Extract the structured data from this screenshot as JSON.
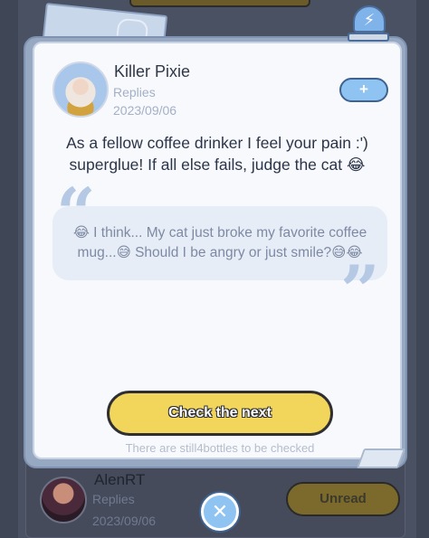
{
  "background_entry": {
    "name": "AlenRT",
    "subtitle": "Replies",
    "date": "2023/09/06",
    "status_button": "Unread"
  },
  "siren": {
    "icon": "lightning-icon",
    "glyph": "⚡"
  },
  "post": {
    "author": "Killer Pixie",
    "subtitle": "Replies",
    "date": "2023/09/06",
    "add_button_glyph": "+",
    "message": "As a fellow coffee drinker I feel your pain :') superglue! If all else fails, judge the cat 😂",
    "quoted_message": "😂 I think... My cat just broke my favorite coffee mug...😅 Should I be angry or just smile?😅😂",
    "quote_open_glyph": "“",
    "quote_close_glyph": "”"
  },
  "actions": {
    "next_button": "Check the next",
    "remaining_text": "There are still4bottles to be checked",
    "close_glyph": "✕"
  },
  "colors": {
    "accent_blue": "#8fc3f2",
    "button_yellow": "#f2d65b",
    "dialog_bg": "#f7f9fd",
    "overlay_bg": "#3f4656"
  }
}
